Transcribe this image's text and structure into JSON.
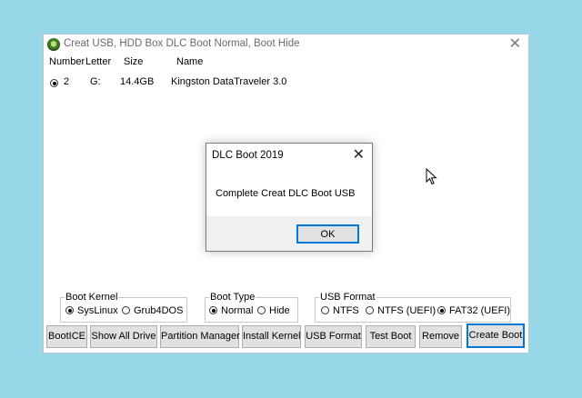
{
  "window": {
    "title": "Creat USB, HDD Box DLC Boot Normal, Boot Hide",
    "icon": "app-disc-icon",
    "close_glyph": "✕"
  },
  "list": {
    "columns": [
      "Number",
      "Letter",
      "Size",
      "Name"
    ],
    "rows": [
      {
        "selected": true,
        "number": "2",
        "letter": "G:",
        "size": "14.4GB",
        "name": "Kingston DataTraveler 3.0"
      }
    ]
  },
  "boot_kernel": {
    "legend": "Boot Kernel",
    "options": [
      "SysLinux",
      "Grub4DOS"
    ],
    "selected": "SysLinux"
  },
  "boot_type": {
    "legend": "Boot Type",
    "options": [
      "Normal",
      "Hide"
    ],
    "selected": "Normal"
  },
  "usb_format": {
    "legend": "USB Format",
    "options": [
      "NTFS",
      "NTFS (UEFI)",
      "FAT32 (UEFI)"
    ],
    "selected": "FAT32 (UEFI)"
  },
  "buttons": [
    "BootICE",
    "Show All Drive",
    "Partition Manager",
    "Install Kernel",
    "USB Format",
    "Test Boot",
    "Remove",
    "Create Boot"
  ],
  "dialog": {
    "title": "DLC Boot 2019",
    "close_glyph": "✕",
    "message": "Complete Creat DLC Boot USB",
    "ok_label": "OK"
  },
  "colors": {
    "desktop": "#98d7e8",
    "focus_border": "#0078d7",
    "button_face": "#e1e1e1"
  }
}
